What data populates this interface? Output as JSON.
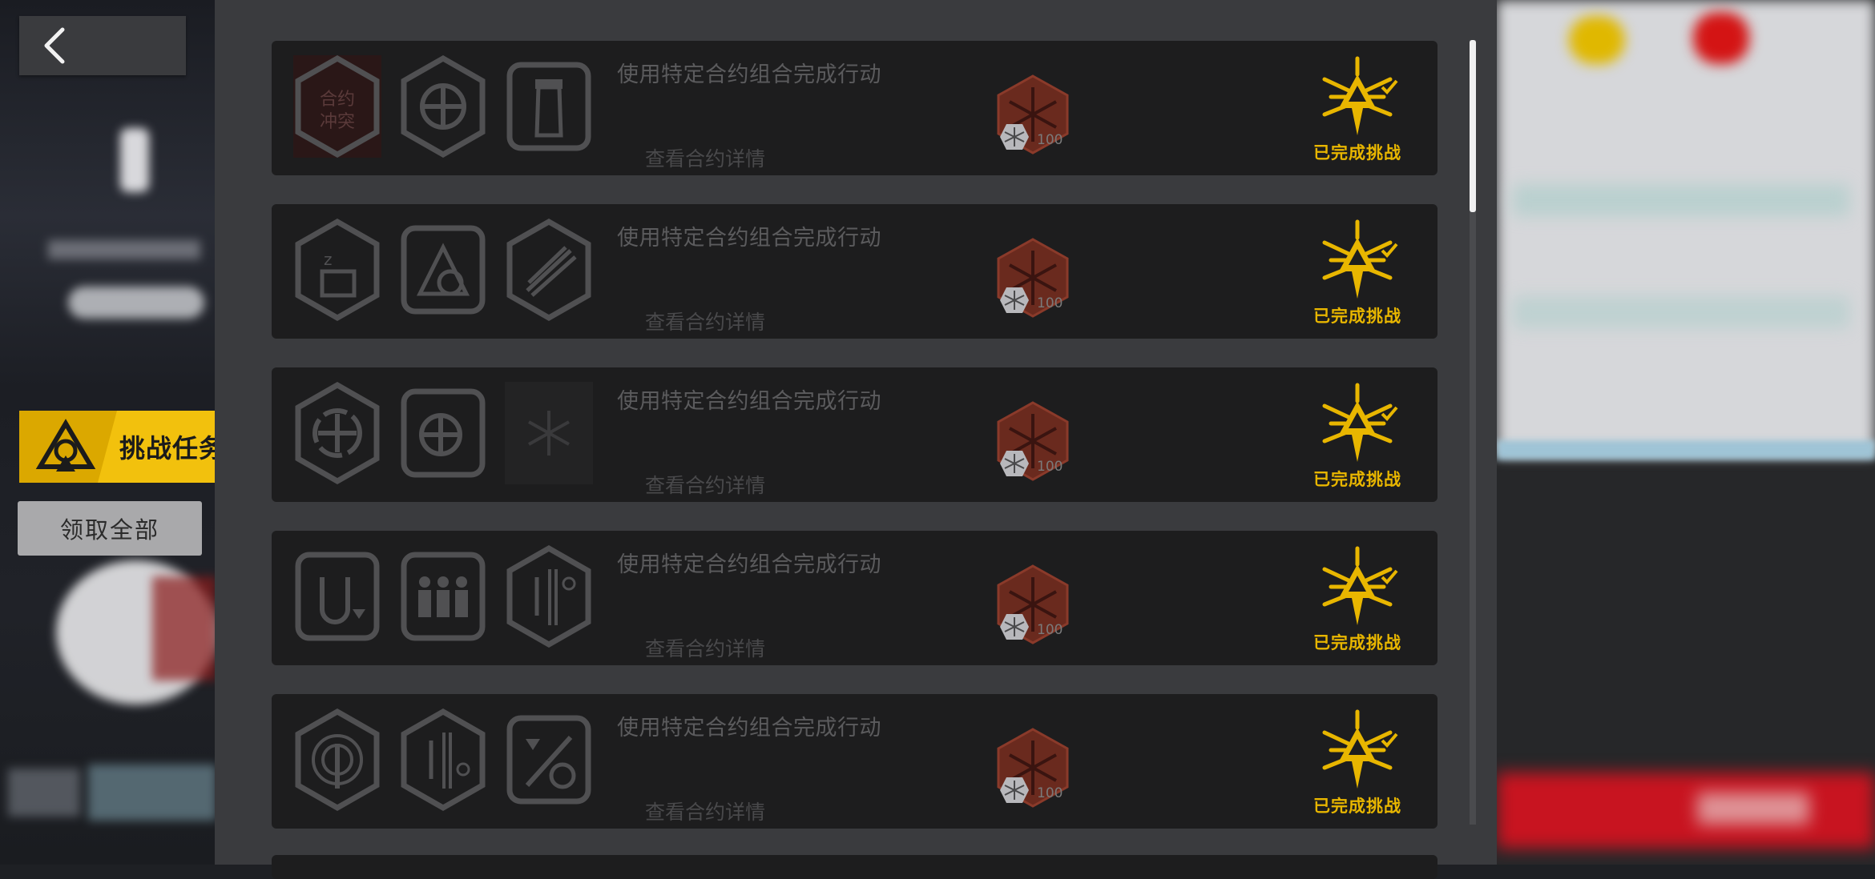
{
  "nav": {
    "back_icon": "chevron-left-icon"
  },
  "sidebar": {
    "challenge_tab_label": "挑战任务",
    "claim_all_label": "领取全部"
  },
  "tasks": [
    {
      "description": "使用特定合约组合完成行动",
      "details_label": "查看合约详情",
      "reward_count": "100",
      "status": "已完成挑战"
    },
    {
      "description": "使用特定合约组合完成行动",
      "details_label": "查看合约详情",
      "reward_count": "100",
      "status": "已完成挑战"
    },
    {
      "description": "使用特定合约组合完成行动",
      "details_label": "查看合约详情",
      "reward_count": "100",
      "status": "已完成挑战"
    },
    {
      "description": "使用特定合约组合完成行动",
      "details_label": "查看合约详情",
      "reward_count": "100",
      "status": "已完成挑战"
    },
    {
      "description": "使用特定合约组合完成行动",
      "details_label": "查看合约详情",
      "reward_count": "100",
      "status": "已完成挑战"
    }
  ],
  "first_contract_icon_text": [
    "合约",
    "冲突"
  ],
  "colors": {
    "accent_yellow": "#f2c10d",
    "status_yellow": "#e8b600",
    "card_bg": "#1d1d1e",
    "panel_bg": "#3a3b3e"
  }
}
